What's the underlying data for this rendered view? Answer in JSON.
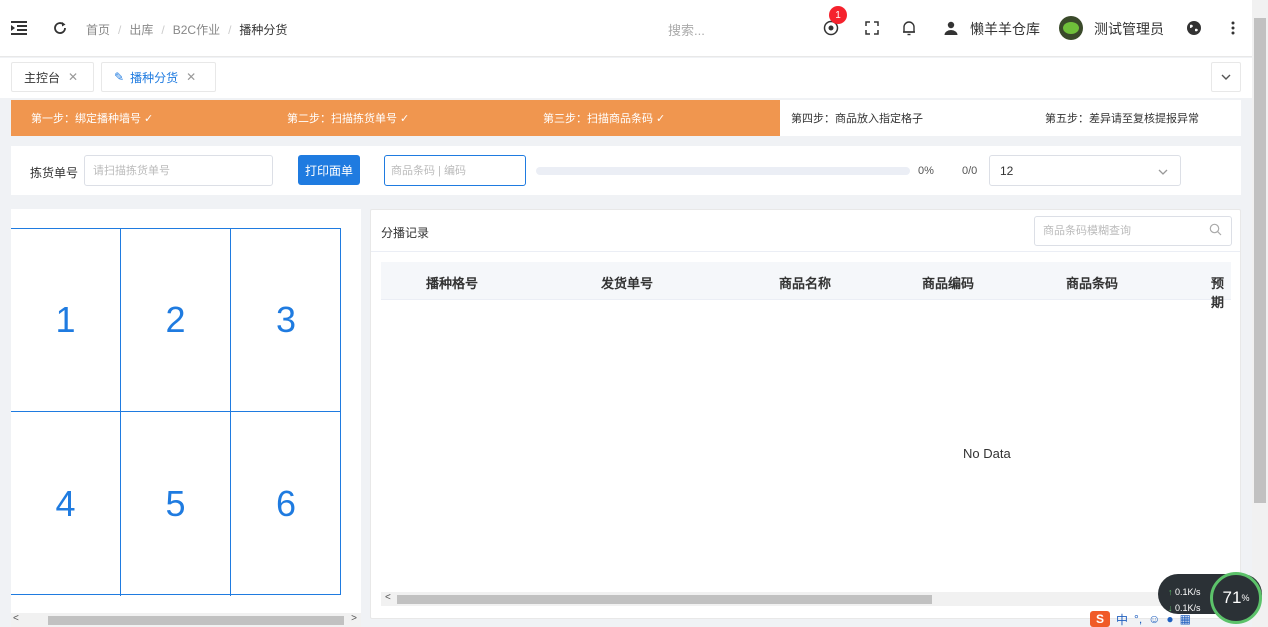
{
  "header": {
    "breadcrumb": [
      "首页",
      "出库",
      "B2C作业",
      "播种分货"
    ],
    "search_placeholder": "搜索...",
    "notification_count": "1",
    "warehouse": "懒羊羊仓库",
    "user": "测试管理员"
  },
  "tabs": [
    {
      "label": "主控台"
    },
    {
      "label": "播种分货"
    }
  ],
  "steps": [
    {
      "label": "第一步：绑定播种墙号 ✓",
      "done": true
    },
    {
      "label": "第二步：扫描拣货单号 ✓",
      "done": true
    },
    {
      "label": "第三步：扫描商品条码 ✓",
      "done": true
    },
    {
      "label": "第四步：商品放入指定格子",
      "done": false
    },
    {
      "label": "第五步：差异请至复核提报异常",
      "done": false
    }
  ],
  "controls": {
    "pick_label": "拣货单号",
    "pick_placeholder": "请扫描拣货单号",
    "print_label": "打印面单",
    "barcode_placeholder": "商品条码 | 编码",
    "progress_percent": 0,
    "progress_text": "0%",
    "count_text": "0/0",
    "grid_select_value": "12"
  },
  "grid": {
    "cells": [
      "1",
      "2",
      "3",
      "4",
      "5",
      "6"
    ]
  },
  "records": {
    "title": "分播记录",
    "search_placeholder": "商品条码模糊查询",
    "columns": [
      "播种格号",
      "发货单号",
      "商品名称",
      "商品编码",
      "商品条码",
      "预期"
    ],
    "empty_text": "No Data"
  },
  "network": {
    "up": "0.1K/s",
    "down": "0.1K/s",
    "percent": "71"
  },
  "ime": {
    "logo": "S",
    "lang": "中"
  },
  "colors": {
    "accent": "#1f7be0",
    "step_done": "#f0964f",
    "badge": "#f5222d"
  }
}
